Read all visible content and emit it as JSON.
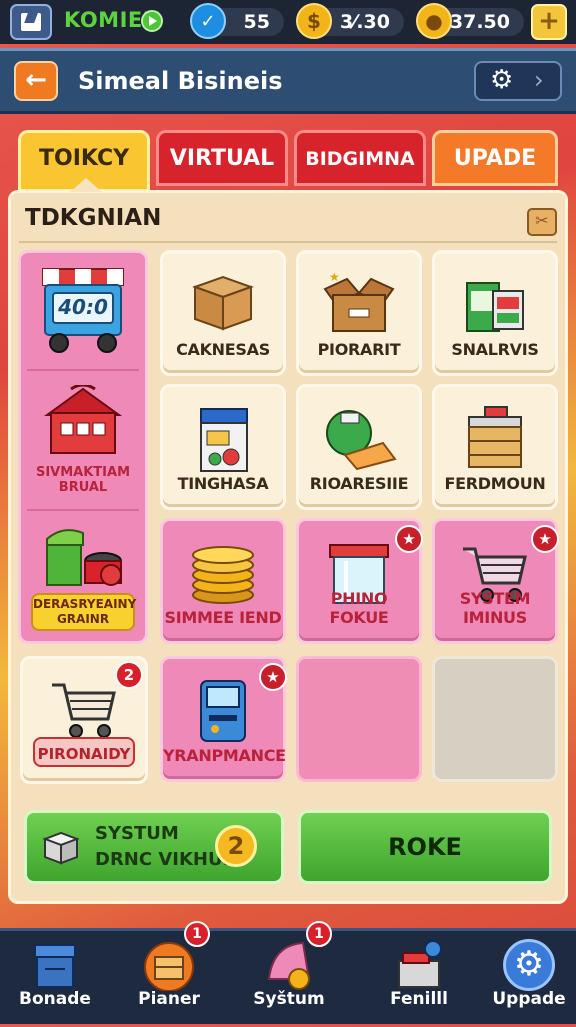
{
  "topbar": {
    "brand": "KOMIEK",
    "stats": [
      {
        "icon": "bird-icon",
        "value": "55"
      },
      {
        "icon": "coin-icon",
        "value": "3⁄.30"
      },
      {
        "icon": "coin-icon",
        "value": "37.50"
      }
    ]
  },
  "header": {
    "title": "Simeal Bisineis"
  },
  "tabs": [
    "TOIKCY",
    "VIRTUAL",
    "BIDGIMNA",
    "UPADE"
  ],
  "panel": {
    "title": "TDKGNIAN"
  },
  "left_items": [
    {
      "icon": "shop-cart-icon",
      "price": "40:0",
      "label": ""
    },
    {
      "icon": "red-store-icon",
      "label_lines": [
        "SIVMAKTIAM",
        "BRUAL"
      ]
    },
    {
      "icon": "green-stall-icon",
      "label_lines": [
        "DERASRYEAINY",
        "GRAINR"
      ]
    }
  ],
  "grid": [
    {
      "label": "CAKNESAS",
      "icon": "box-icon"
    },
    {
      "label": "PIORARIT",
      "icon": "open-box-icon"
    },
    {
      "label": "SNALRVIS",
      "icon": "book-stack-icon"
    },
    {
      "label": "TINGHASA",
      "icon": "seed-box-icon"
    },
    {
      "label": "RIOARESIIE",
      "icon": "can-icon"
    },
    {
      "label": "FERDMOUN",
      "icon": "crate-icon"
    },
    {
      "label": "SIMMEE IEND",
      "icon": "coin-stack-icon"
    },
    {
      "label": "PHINO FOKUE",
      "icon": "display-case-icon",
      "badge": "★"
    },
    {
      "label": "SYSTEM IMINUS",
      "icon": "shopping-cart-icon",
      "badge": "★"
    },
    {
      "label": "PIRONAIDY",
      "icon": "shopping-cart-icon",
      "badge": "2"
    },
    {
      "label": "YRANPMANCE",
      "icon": "arcade-icon",
      "badge": "★"
    }
  ],
  "actions": {
    "left_line1": "SYSTUM",
    "left_line2": "DRNC VIKHUS",
    "left_coin": "2",
    "right": "ROKE"
  },
  "nav": [
    {
      "label": "Bonade",
      "icon": "crate-icon"
    },
    {
      "label": "Pianer",
      "icon": "chest-icon",
      "badge": "1"
    },
    {
      "label": "Syštum",
      "icon": "ticket-coin-icon",
      "badge": "1"
    },
    {
      "label": "Fenilll",
      "icon": "toolbox-icon"
    },
    {
      "label": "Uppade",
      "icon": "gear-icon"
    }
  ]
}
